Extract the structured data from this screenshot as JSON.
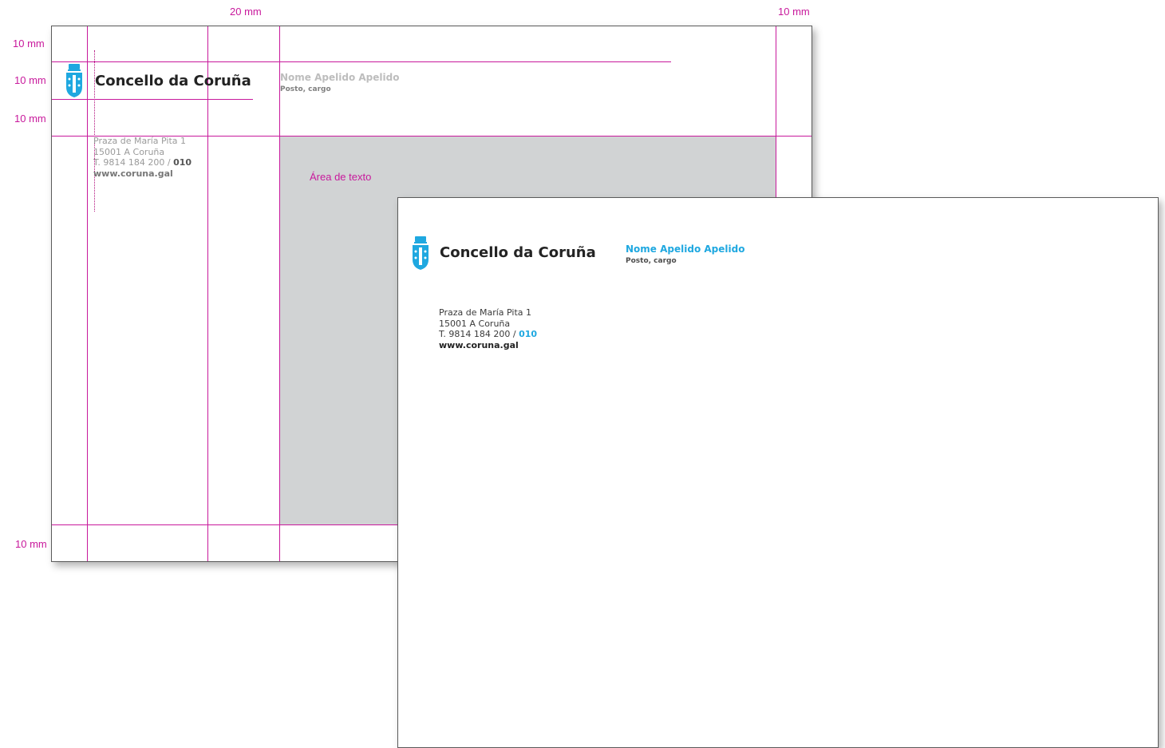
{
  "colors": {
    "guide": "#c8199c",
    "brand_blue": "#1fa8e0",
    "text_dark": "#232323",
    "text_grey": "#9a9a9a",
    "text_area_fill": "#d1d3d4"
  },
  "dimensions": {
    "top_left": "20 mm",
    "top_right": "10 mm",
    "left_1": "10 mm",
    "left_2": "10 mm",
    "left_3": "10 mm",
    "left_bottom": "10 mm"
  },
  "guide_sheet": {
    "brand_name": "Concello da Coruña",
    "person_name": "Nome Apelido Apelido",
    "person_role": "Posto, cargo",
    "address_line1": "Praza de María Pita 1",
    "address_line2": "15001 A Coruña",
    "phone_prefix": "T. 9814 184 200 / ",
    "phone_short": "010",
    "website": "www.coruna.gal",
    "text_area_label": "Área de texto"
  },
  "final_sheet": {
    "brand_name": "Concello da Coruña",
    "person_name": "Nome Apelido Apelido",
    "person_role": "Posto, cargo",
    "address_line1": "Praza de María Pita 1",
    "address_line2": "15001 A Coruña",
    "phone_prefix": "T. 9814 184 200 / ",
    "phone_short": "010",
    "website": "www.coruna.gal"
  },
  "icons": {
    "coat_of_arms": "coat-of-arms-icon"
  }
}
